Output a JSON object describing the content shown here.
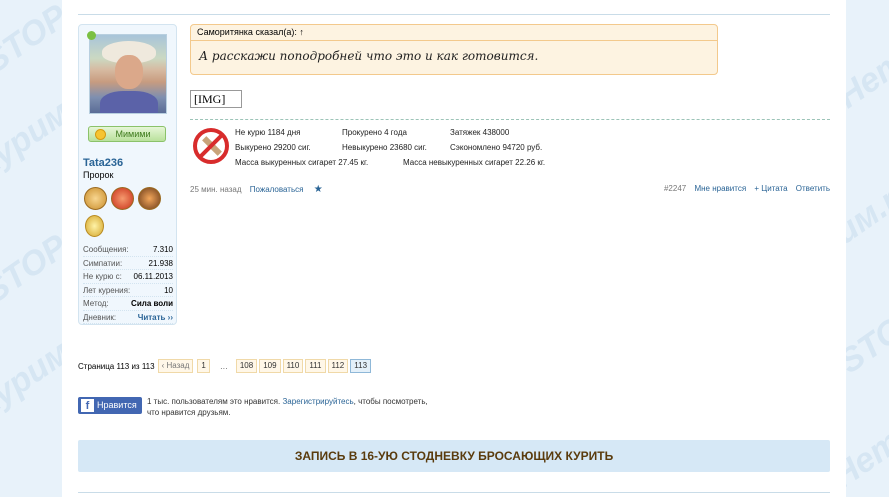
{
  "user": {
    "mood_label": "Мимими",
    "name": "Tata236",
    "title": "Пророк",
    "stats": [
      {
        "key": "Сообщения:",
        "value": "7.310"
      },
      {
        "key": "Симпатии:",
        "value": "21.938"
      },
      {
        "key": "Не курю с:",
        "value": "06.11.2013"
      },
      {
        "key": "Лет курения:",
        "value": "10"
      },
      {
        "key": "Метод:",
        "value": "Сила воли"
      },
      {
        "key": "Дневник:",
        "value": "Читать ››"
      }
    ]
  },
  "quote": {
    "header": "Саморитянка сказал(а): ↑",
    "text": "А расскажи поподробней что это и как готовится."
  },
  "image_placeholder": "[IMG]",
  "signature": {
    "no_smoke_days": "Не курю 1184 дня",
    "smoked_years": "Прокурено 4 года",
    "puffs": "Затяжек 438000",
    "not_smoked_count": "Выкурено 29200 сиг.",
    "unsmoked": "Невыкурено 23680 сиг.",
    "saved": "Сэкономлено 94720 руб.",
    "mass_smoked": "Масса выкуренных сигарет 27.45 кг.",
    "mass_unsmoked": "Масса невыкуренных сигарет 22.26 кг."
  },
  "post_footer": {
    "time": "25 мин. назад",
    "report": "Пожаловаться",
    "star": "★",
    "post_number": "#2247",
    "like": "Мне нравится",
    "quote": "+ Цитата",
    "reply": "Ответить"
  },
  "pagination": {
    "label": "Страница 113 из 113",
    "prev": "‹ Назад",
    "first": "1",
    "dots": "…",
    "pages": [
      "108",
      "109",
      "110",
      "111",
      "112",
      "113"
    ],
    "current": "113"
  },
  "facebook": {
    "button_label": "Нравится",
    "text_before": "1 тыс. пользователям это нравится.",
    "link": "Зарегистрируйтесь",
    "text_after": ", чтобы посмотреть, что нравится друзьям."
  },
  "banner": "ЗАПИСЬ В 16-УЮ СТОДНЕВКУ БРОСАЮЩИХ КУРИТЬ"
}
